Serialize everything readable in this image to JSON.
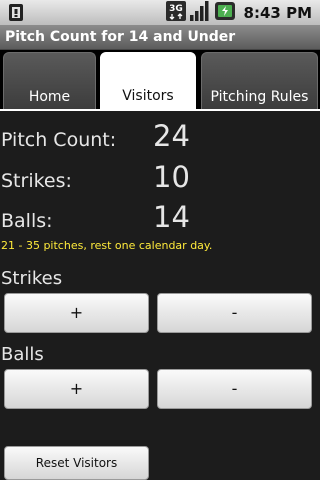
{
  "status_bar": {
    "time": "8:43 PM",
    "network": "3G",
    "icons": [
      "sim-icon",
      "network-3g-icon",
      "signal-icon",
      "battery-icon"
    ]
  },
  "app": {
    "title": "Pitch Count for 14 and Under"
  },
  "tabs": [
    {
      "label": "Home",
      "active": false
    },
    {
      "label": "Visitors",
      "active": true
    },
    {
      "label": "Pitching Rules",
      "active": false
    }
  ],
  "stats": {
    "pitch_count_label": "Pitch Count:",
    "pitch_count_value": "24",
    "strikes_label": "Strikes:",
    "strikes_value": "10",
    "balls_label": "Balls:",
    "balls_value": "14",
    "rest_note": "21 - 35 pitches, rest one calendar day."
  },
  "strikes_section": {
    "heading": "Strikes",
    "plus_label": "+",
    "minus_label": "-"
  },
  "balls_section": {
    "heading": "Balls",
    "plus_label": "+",
    "minus_label": "-"
  },
  "reset_label": "Reset Visitors",
  "colors": {
    "note_yellow": "#ffeb3b",
    "background": "#1c1c1c"
  }
}
